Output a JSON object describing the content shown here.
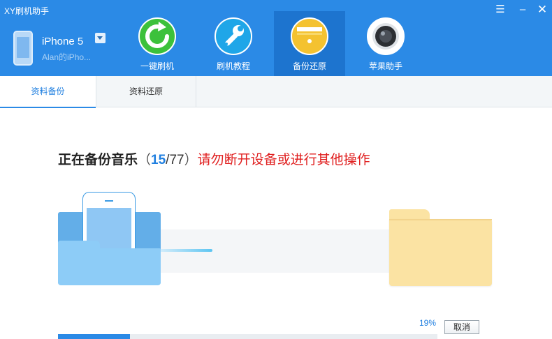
{
  "app": {
    "title": "XY刷机助手"
  },
  "window_controls": {
    "menu_glyph": "☰",
    "min_glyph": "–",
    "close_glyph": "✕"
  },
  "device": {
    "name": "iPhone 5",
    "subtitle": "Alan的iPho..."
  },
  "nav": [
    {
      "label": "一键刷机",
      "icon": "flash-refresh-icon"
    },
    {
      "label": "刷机教程",
      "icon": "wrench-icon"
    },
    {
      "label": "备份还原",
      "icon": "backup-box-icon"
    },
    {
      "label": "苹果助手",
      "icon": "camera-lens-icon"
    }
  ],
  "tabs": [
    {
      "label": "资料备份"
    },
    {
      "label": "资料还原"
    }
  ],
  "status": {
    "prefix": "正在备份音乐",
    "open_paren": "（",
    "current": "15",
    "separator": "/",
    "total": "77",
    "close_paren": "）",
    "warning": "请勿断开设备或进行其他操作"
  },
  "progress": {
    "percent_label": "19%",
    "fraction": 0.19
  },
  "actions": {
    "cancel_label": "取消"
  },
  "colors": {
    "header": "#2b8ae6",
    "nav_active": "#1d74cf",
    "accent": "#1f7fe0",
    "warning": "#e02020",
    "progress_fill": "#2b8ae6"
  }
}
